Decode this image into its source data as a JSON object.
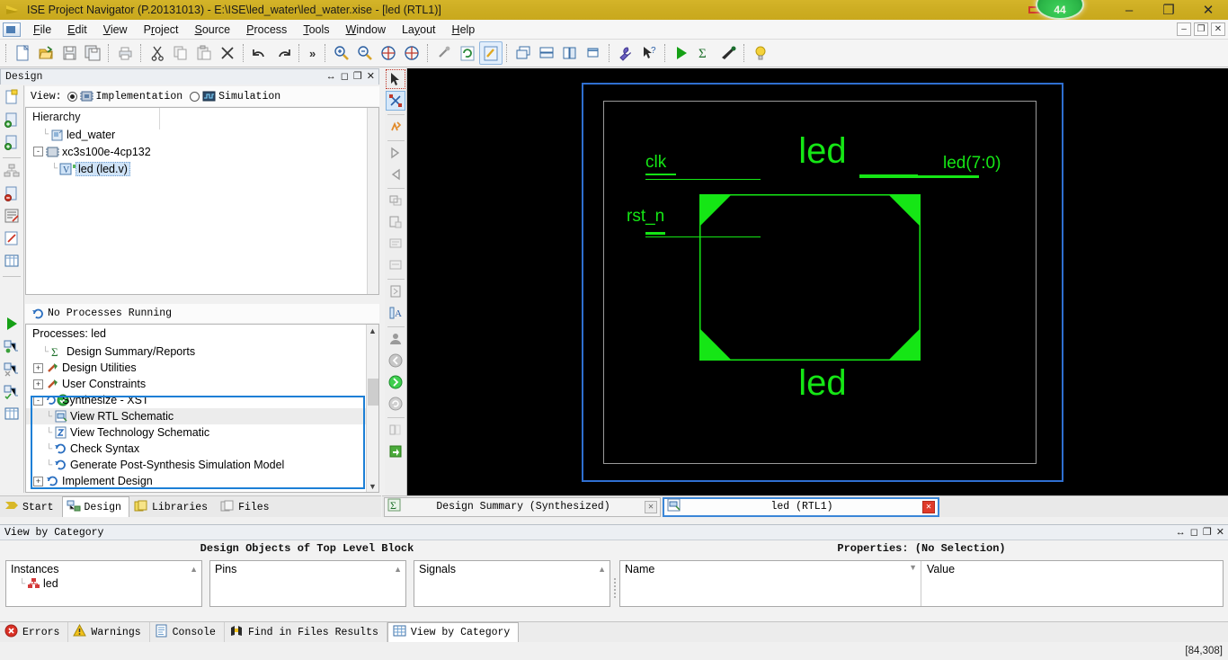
{
  "titlebar": {
    "icon": "ise-logo-icon",
    "text": "ISE Project Navigator (P.20131013) - E:\\ISE\\led_water\\led_water.xise - [led (RTL1)]",
    "badge_value": "44",
    "minimize": "–",
    "maximize": "❐",
    "close": "✕"
  },
  "menubar": {
    "items": [
      {
        "label": "File"
      },
      {
        "label": "Edit"
      },
      {
        "label": "View"
      },
      {
        "label": "Project"
      },
      {
        "label": "Source"
      },
      {
        "label": "Process"
      },
      {
        "label": "Tools"
      },
      {
        "label": "Window"
      },
      {
        "label": "Layout"
      },
      {
        "label": "Help"
      }
    ],
    "mdi_minimize": "–",
    "mdi_restore": "❐",
    "mdi_close": "✕"
  },
  "toolbar": {
    "buttons": [
      {
        "name": "new-file-icon"
      },
      {
        "name": "open-file-icon"
      },
      {
        "name": "save-icon"
      },
      {
        "name": "save-all-icon"
      },
      {
        "name": "print-icon"
      },
      {
        "name": "cut-icon"
      },
      {
        "name": "copy-icon"
      },
      {
        "name": "paste-icon"
      },
      {
        "name": "delete-icon"
      },
      {
        "name": "undo-icon"
      },
      {
        "name": "redo-icon"
      },
      {
        "name": "more-icon"
      },
      {
        "name": "zoom-in-icon"
      },
      {
        "name": "zoom-out-icon"
      },
      {
        "name": "zoom-fit-icon"
      },
      {
        "name": "zoom-area-icon"
      },
      {
        "name": "pan-icon"
      },
      {
        "name": "refresh-icon"
      },
      {
        "name": "design-goals-icon"
      },
      {
        "name": "tile-cascade-icon"
      },
      {
        "name": "tile-horizontal-icon"
      },
      {
        "name": "tile-vertical-icon"
      },
      {
        "name": "new-window-icon"
      },
      {
        "name": "settings-wrench-icon"
      },
      {
        "name": "context-help-icon"
      },
      {
        "name": "run-icon"
      },
      {
        "name": "design-summary-icon"
      },
      {
        "name": "impact-icon"
      },
      {
        "name": "tip-bulb-icon"
      }
    ]
  },
  "left_strip": {
    "icons": [
      "new-source-icon",
      "add-source-icon",
      "add-copy-source-icon",
      "hierarchy-icon",
      "remove-source-icon",
      "manage-config-icon",
      "edit-constraints-icon",
      "design-table-icon",
      "run-process-icon",
      "process-props-icon",
      "process-rerun-icon",
      "process-rerun-all-icon",
      "process-table-icon"
    ]
  },
  "design_panel": {
    "title": "Design",
    "controls": [
      "float-icon",
      "maximize-icon",
      "restore-icon",
      "close-icon"
    ],
    "view": {
      "label": "View:",
      "options": [
        {
          "label": "Implementation",
          "icon": "chip-icon",
          "selected": true
        },
        {
          "label": "Simulation",
          "icon": "waveform-icon",
          "selected": false
        }
      ]
    },
    "hierarchy": {
      "header": "Hierarchy",
      "nodes": [
        {
          "label": "led_water",
          "icon": "project-icon",
          "indent": 1,
          "expander": "",
          "selected": false
        },
        {
          "label": "xc3s100e-4cp132",
          "icon": "device-icon",
          "indent": 0,
          "expander": "-",
          "selected": false
        },
        {
          "label": "led (led.v)",
          "icon": "verilog-module-icon",
          "indent": 2,
          "expander": "",
          "selected": true
        }
      ]
    },
    "processes": {
      "status": "No Processes Running",
      "status_icon": "refresh-icon",
      "header": "Processes: led",
      "rows": [
        {
          "label": "Design Summary/Reports",
          "icon": "summary-icon",
          "expander": "",
          "indent": 1,
          "highlight": false
        },
        {
          "label": "Design Utilities",
          "icon": "utilities-icon",
          "expander": "+",
          "indent": 0,
          "highlight": false
        },
        {
          "label": "User Constraints",
          "icon": "constraints-icon",
          "expander": "+",
          "indent": 0,
          "highlight": false
        },
        {
          "label": "Synthesize - XST",
          "icon": "process-done-icon",
          "expander": "-",
          "indent": 0,
          "highlight": false
        },
        {
          "label": "View RTL Schematic",
          "icon": "rtl-schematic-icon",
          "expander": "",
          "indent": 2,
          "highlight": true
        },
        {
          "label": "View Technology Schematic",
          "icon": "tech-schematic-icon",
          "expander": "",
          "indent": 2,
          "highlight": false
        },
        {
          "label": "Check Syntax",
          "icon": "refresh-icon",
          "expander": "",
          "indent": 2,
          "highlight": false
        },
        {
          "label": "Generate Post-Synthesis Simulation Model",
          "icon": "refresh-icon",
          "expander": "",
          "indent": 2,
          "highlight": false
        },
        {
          "label": "Implement Design",
          "icon": "refresh-icon",
          "expander": "+",
          "indent": 0,
          "highlight": false
        }
      ]
    },
    "tabs": [
      {
        "label": "Start",
        "icon": "start-icon",
        "active": false
      },
      {
        "label": "Design",
        "icon": "design-icon",
        "active": true
      },
      {
        "label": "Libraries",
        "icon": "libraries-icon",
        "active": false
      },
      {
        "label": "Files",
        "icon": "files-icon",
        "active": false
      }
    ]
  },
  "schematic_toolbar": {
    "icons": [
      "select-tool-icon",
      "select-area-icon",
      "add-icon",
      "zoom-in-symbol-icon",
      "zoom-out-symbol-icon",
      "push-into-icon",
      "pop-out-icon",
      "rename-icon",
      "remove-icon",
      "schematic-page-icon",
      "text-tool-icon",
      "person-icon",
      "back-icon",
      "forward-icon",
      "refresh-schematic-icon",
      "new-sheet-icon",
      "export-icon"
    ]
  },
  "schematic": {
    "title_top": "led",
    "title_bottom": "led",
    "inputs": [
      {
        "label": "clk"
      },
      {
        "label": "rst_n"
      }
    ],
    "outputs": [
      {
        "label": "led(7:0)"
      }
    ],
    "accent_color": "#15e615",
    "background_color": "#000000",
    "border_color": "#2f6fd0"
  },
  "doc_tabs": [
    {
      "label": "Design Summary (Synthesized)",
      "icon": "summary-icon",
      "active": false,
      "close": "✕"
    },
    {
      "label": "led (RTL1)",
      "icon": "rtl-schematic-icon",
      "active": true,
      "close": "✕"
    }
  ],
  "view_by_category": {
    "panel_title": "View by Category",
    "controls": [
      "float-icon",
      "maximize-icon",
      "restore-icon",
      "close-icon"
    ],
    "objects_title": "Design Objects of Top Level Block",
    "properties_title": "Properties: (No Selection)",
    "columns": [
      {
        "header": "Instances",
        "rows": [
          {
            "label": "led",
            "icon": "instance-icon"
          }
        ]
      },
      {
        "header": "Pins",
        "rows": []
      },
      {
        "header": "Signals",
        "rows": []
      }
    ],
    "properties_columns": [
      {
        "header": "Name"
      },
      {
        "header": "Value"
      }
    ]
  },
  "bottom_tabs": [
    {
      "label": "Errors",
      "icon": "error-icon",
      "active": false
    },
    {
      "label": "Warnings",
      "icon": "warning-icon",
      "active": false
    },
    {
      "label": "Console",
      "icon": "console-icon",
      "active": false
    },
    {
      "label": "Find in Files Results",
      "icon": "find-icon",
      "active": false
    },
    {
      "label": "View by Category",
      "icon": "grid-icon",
      "active": true
    }
  ],
  "statusbar": {
    "coordinates": "[84,308]"
  }
}
